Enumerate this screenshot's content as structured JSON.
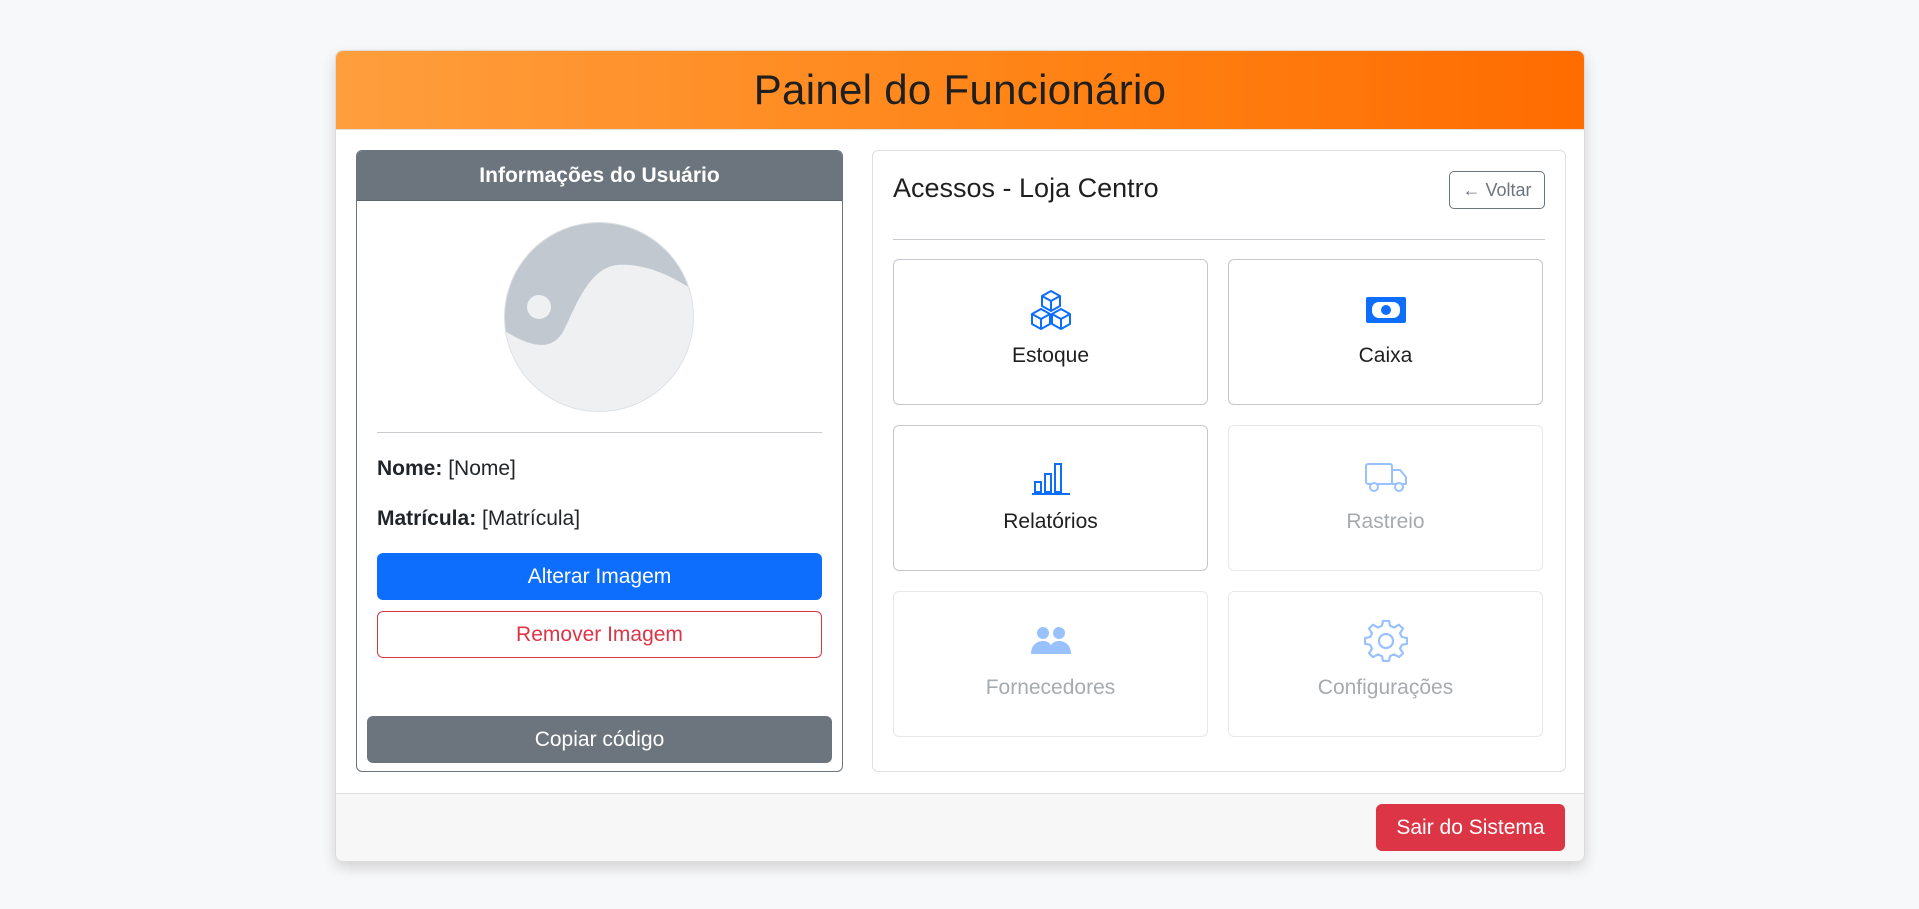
{
  "header": {
    "title": "Painel do Funcionário"
  },
  "user_card": {
    "title": "Informações do Usuário",
    "name_label": "Nome:",
    "name_value": "[Nome]",
    "registration_label": "Matrícula:",
    "registration_value": "[Matrícula]",
    "change_image_label": "Alterar Imagem",
    "remove_image_label": "Remover Imagem",
    "copy_code_label": "Copiar código"
  },
  "access": {
    "title": "Acessos - Loja Centro",
    "back_label": "← Voltar",
    "tiles": [
      {
        "label": "Estoque",
        "icon": "boxes-icon",
        "enabled": true
      },
      {
        "label": "Caixa",
        "icon": "cash-icon",
        "enabled": true
      },
      {
        "label": "Relatórios",
        "icon": "bar-chart-icon",
        "enabled": true
      },
      {
        "label": "Rastreio",
        "icon": "truck-icon",
        "enabled": false
      },
      {
        "label": "Fornecedores",
        "icon": "people-icon",
        "enabled": false
      },
      {
        "label": "Configurações",
        "icon": "gear-icon",
        "enabled": false
      }
    ]
  },
  "footer": {
    "logout_label": "Sair do Sistema"
  },
  "colors": {
    "header_gradient_start": "#ff9e3d",
    "header_gradient_end": "#ff6c00",
    "primary": "#0d6efd",
    "danger": "#dc3545",
    "secondary": "#6c757d"
  }
}
